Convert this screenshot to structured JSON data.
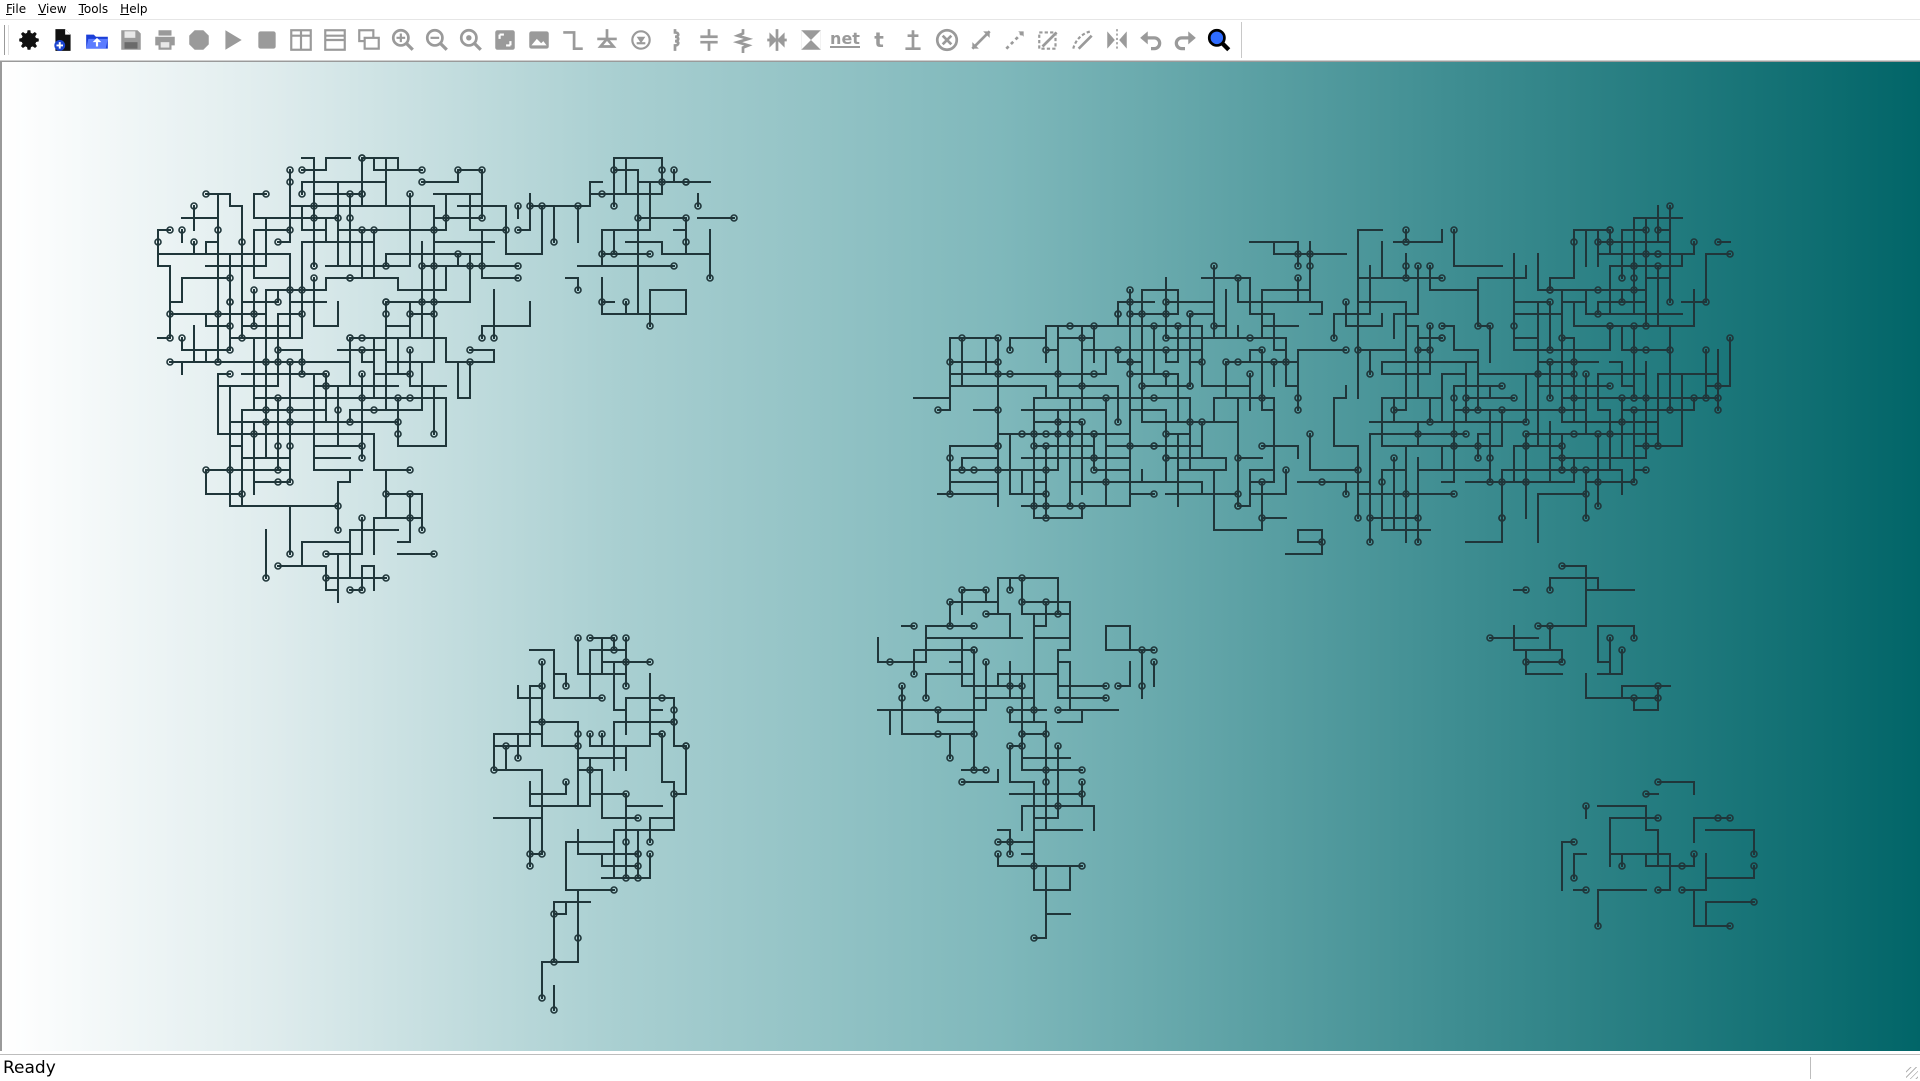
{
  "menu": [
    {
      "mnemonic": "F",
      "rest": "ile"
    },
    {
      "mnemonic": "V",
      "rest": "iew"
    },
    {
      "mnemonic": "T",
      "rest": "ools"
    },
    {
      "mnemonic": "H",
      "rest": "elp"
    }
  ],
  "toolbar": {
    "tools": [
      "settings-gear-icon",
      "new-document-icon",
      "open-folder-icon",
      "save-icon",
      "print-icon",
      "stop-hexagon-icon",
      "run-icon",
      "stop-square-icon",
      "split-vertical-icon",
      "split-horizontal-icon",
      "layers-icon",
      "zoom-in-icon",
      "zoom-out-icon",
      "zoom-fit-icon",
      "zoom-window-icon",
      "image-icon",
      "wire-icon",
      "ground-icon",
      "diode-icon",
      "inductor-icon",
      "capacitor-icon",
      "resistor-icon",
      "junction-icon",
      "bus-icon",
      "net-label-icon",
      "text-tool-icon",
      "pin-tool-icon",
      "delete-circle-icon",
      "draw-line-icon",
      "draw-dashed-icon",
      "polygon-icon",
      "freehand-icon",
      "mirror-icon",
      "undo-icon",
      "redo-icon",
      "find-icon"
    ],
    "net_label": "net",
    "text_label": "t"
  },
  "canvas": {
    "background": {
      "left": "#ffffff",
      "right": "#016568"
    },
    "trace_color": "#20363a"
  },
  "status": {
    "text": "Ready"
  }
}
